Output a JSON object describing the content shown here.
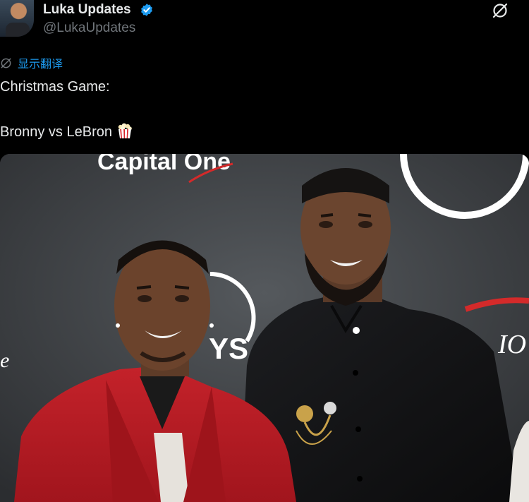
{
  "author": {
    "display_name": "Luka Updates",
    "handle": "@LukaUpdates",
    "avatar_alt": "avatar",
    "verified": true
  },
  "actions": {
    "grok_icon": "grok-icon"
  },
  "translate": {
    "label": "显示翻译",
    "icon": "globe-icon"
  },
  "post": {
    "line1": "Christmas Game:",
    "line2": "Bronny vs LeBron",
    "emoji": "popcorn"
  },
  "media": {
    "backdrop_text": "Capital One",
    "backdrop_text_2": "YS",
    "backdrop_text_3": "IO",
    "backdrop_text_4": "e"
  },
  "colors": {
    "background": "#000000",
    "text": "#e7e9ea",
    "secondary": "#71767b",
    "link": "#1d9bf0",
    "verified": "#1d9bf0"
  }
}
